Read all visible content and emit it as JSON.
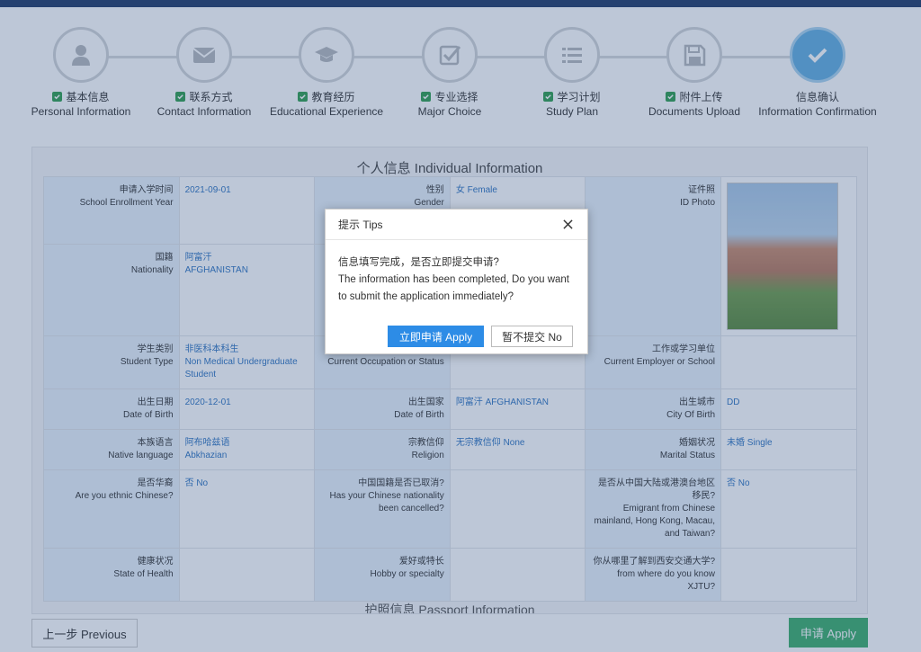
{
  "steps": [
    {
      "cn": "基本信息",
      "en": "Personal Information",
      "icon": "user-icon",
      "done": true
    },
    {
      "cn": "联系方式",
      "en": "Contact Information",
      "icon": "envelope-icon",
      "done": true
    },
    {
      "cn": "教育经历",
      "en": "Educational Experience",
      "icon": "graduation-cap-icon",
      "done": true
    },
    {
      "cn": "专业选择",
      "en": "Major Choice",
      "icon": "checkbox-icon",
      "done": true
    },
    {
      "cn": "学习计划",
      "en": "Study Plan",
      "icon": "list-icon",
      "done": true
    },
    {
      "cn": "附件上传",
      "en": "Documents Upload",
      "icon": "floppy-disk-icon",
      "done": true
    },
    {
      "cn": "信息确认",
      "en": "Information Confirmation",
      "icon": "check-icon",
      "done": false
    }
  ],
  "panel": {
    "title": "个人信息 Individual Information",
    "next_section": "护照信息 Passport Information"
  },
  "info": {
    "enroll_label_cn": "申请入学时间",
    "enroll_label_en": "School Enrollment Year",
    "enroll_value": "2021-09-01",
    "gender_label_cn": "性别",
    "gender_label_en": "Gender",
    "gender_value": "女 Female",
    "photo_label_cn": "证件照",
    "photo_label_en": "ID Photo",
    "nationality_label_cn": "国籍",
    "nationality_label_en": "Nationality",
    "nationality_value_cn": "阿富汗",
    "nationality_value_en": "AFGHANISTAN",
    "student_type_label_cn": "学生类别",
    "student_type_label_en": "Student Type",
    "student_type_value_cn": "非医科本科生",
    "student_type_value_en": "Non Medical Undergraduate Student",
    "occupation_label_en": "Current Occupation or Status",
    "employer_label_cn": "工作或学习单位",
    "employer_label_en": "Current Employer or School",
    "dob_label_cn": "出生日期",
    "dob_label_en": "Date of Birth",
    "dob_value": "2020-12-01",
    "birth_country_label_cn": "出生国家",
    "birth_country_label_en": "Date of Birth",
    "birth_country_value": "阿富汗 AFGHANISTAN",
    "birth_city_label_cn": "出生城市",
    "birth_city_label_en": "City Of Birth",
    "birth_city_value": "DD",
    "language_label_cn": "本族语言",
    "language_label_en": "Native language",
    "language_value_cn": "阿布哈兹语",
    "language_value_en": "Abkhazian",
    "religion_label_cn": "宗教信仰",
    "religion_label_en": "Religion",
    "religion_value": "无宗教信仰 None",
    "marital_label_cn": "婚姻状况",
    "marital_label_en": "Marital Status",
    "marital_value": "未婚 Single",
    "ethnic_label_cn": "是否华裔",
    "ethnic_label_en": "Are you ethnic Chinese?",
    "ethnic_value": "否 No",
    "cancelled_label_cn": "中国国籍是否已取消?",
    "cancelled_label_en": "Has your Chinese nationality been cancelled?",
    "emigrant_label_cn": "是否从中国大陆或港澳台地区移民?",
    "emigrant_label_en": "Emigrant from Chinese mainland, Hong Kong, Macau, and Taiwan?",
    "emigrant_value": "否 No",
    "health_label_cn": "健康状况",
    "health_label_en": "State of Health",
    "hobby_label_cn": "爱好或特长",
    "hobby_label_en": "Hobby or specialty",
    "know_label_cn": "你从哪里了解到西安交通大学?",
    "know_label_en": "from where do you know XJTU?"
  },
  "buttons": {
    "previous": "上一步 Previous",
    "apply": "申请 Apply"
  },
  "dialog": {
    "title": "提示 Tips",
    "message_cn": "信息填写完成，是否立即提交申请?",
    "message_en": "The information has been completed, Do you want to submit the application immediately?",
    "apply": "立即申请 Apply",
    "no": "暂不提交 No"
  },
  "colors": {
    "overlay": "#325082",
    "primary": "#2d8ce6",
    "success": "#3cae6a",
    "topbar": "#1f3a67"
  }
}
